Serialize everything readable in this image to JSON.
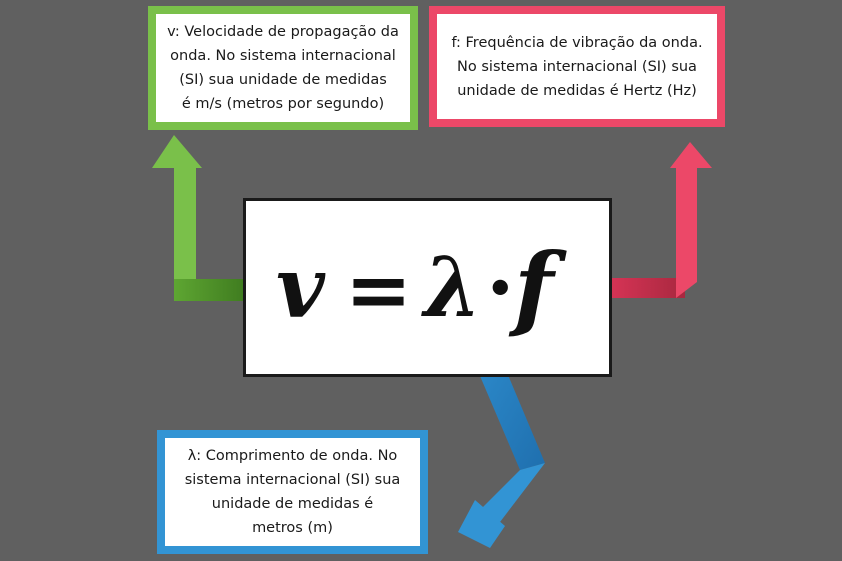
{
  "formula": {
    "v": "v",
    "equals": "=",
    "lambda": "λ",
    "dot": "·",
    "f": "f"
  },
  "definitions": {
    "velocity": {
      "lines": [
        "v: Velocidade de propagação da",
        "onda. No sistema internacional",
        "(SI) sua unidade de medidas",
        "é m/s (metros por segundo)"
      ],
      "color": "#7ac04a"
    },
    "frequency": {
      "lines": [
        "f: Frequência de vibração da onda.",
        "No sistema internacional (SI) sua",
        "unidade de medidas é Hertz (Hz)"
      ],
      "color": "#ec4868"
    },
    "wavelength": {
      "lines": [
        "λ: Comprimento de onda. No",
        "sistema internacional (SI) sua",
        "unidade de medidas é",
        "metros (m)"
      ],
      "color": "#3294d4"
    }
  },
  "background": "#606060"
}
